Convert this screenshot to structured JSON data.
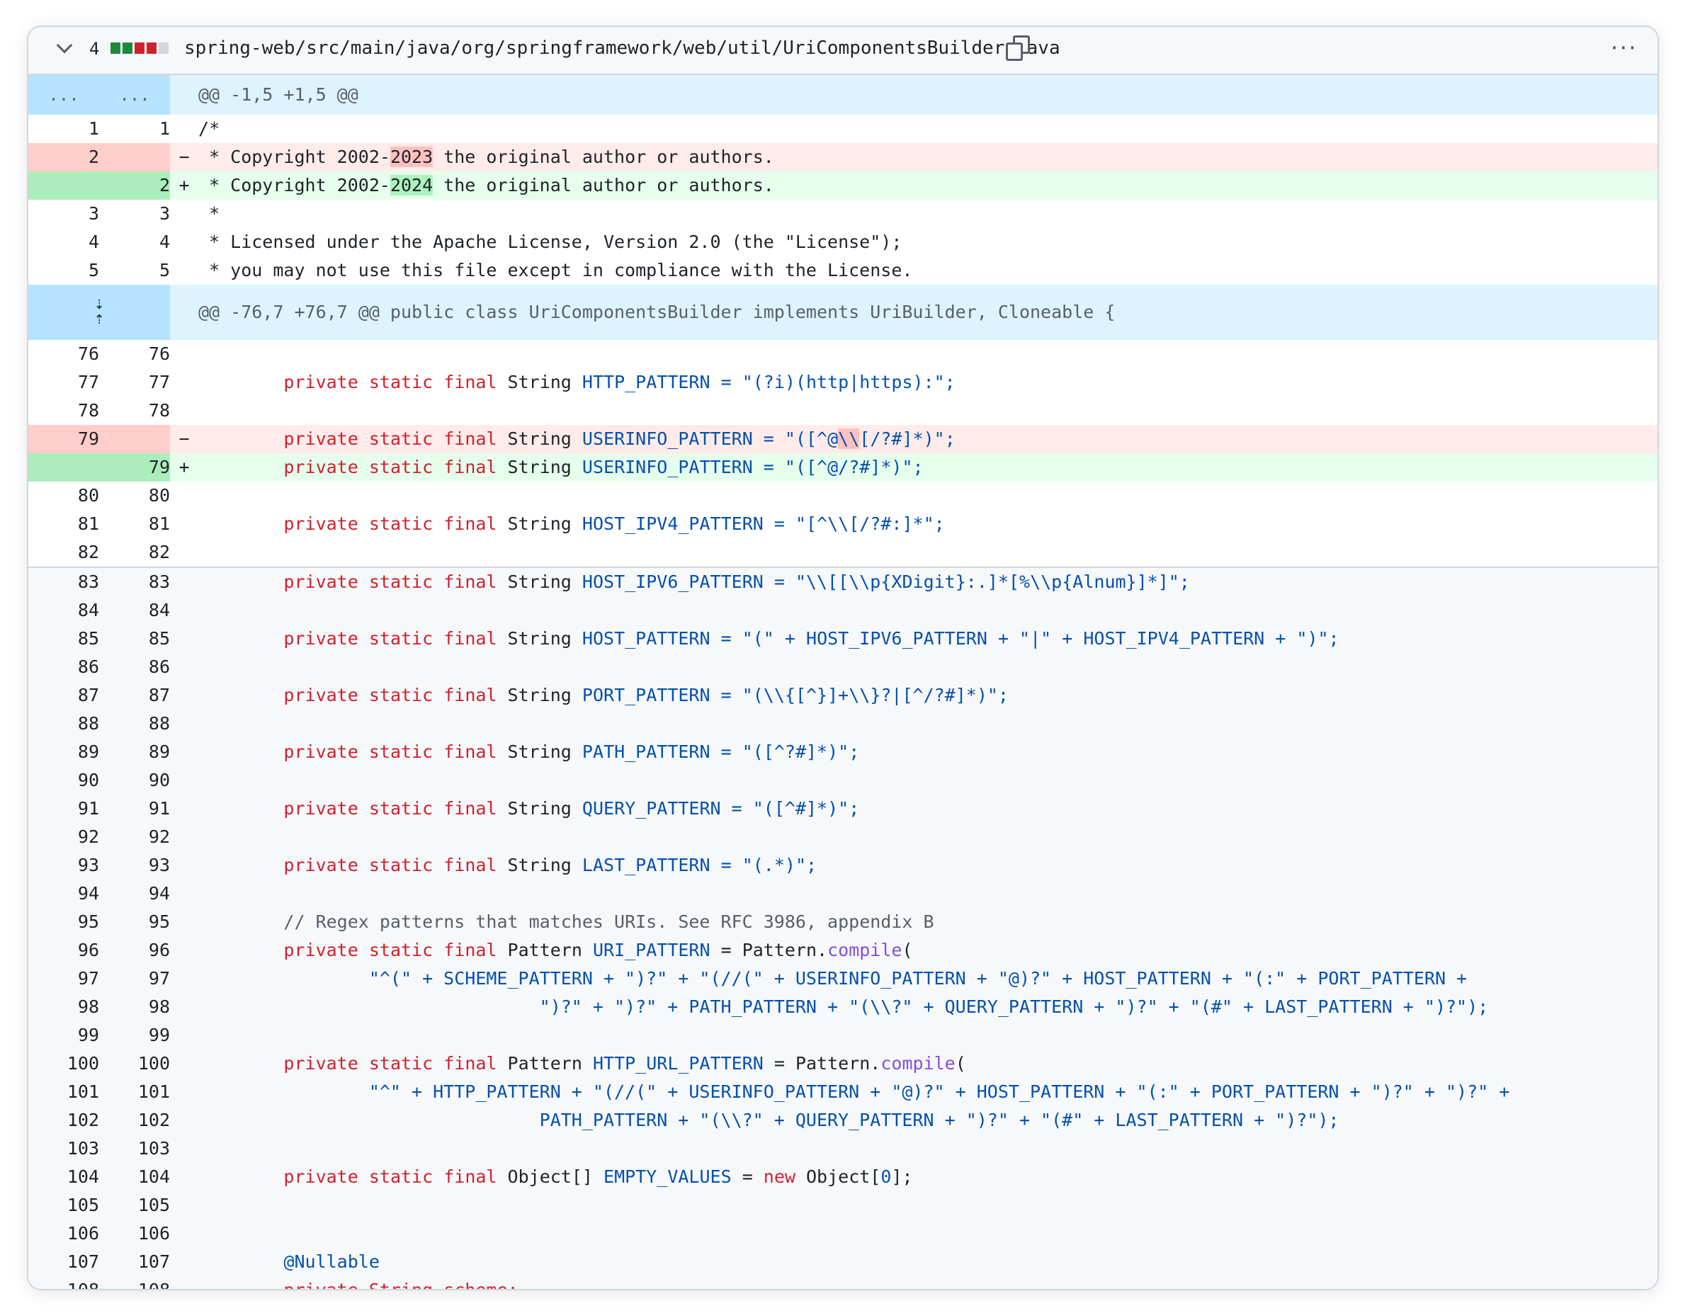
{
  "file": {
    "changes_count": "4",
    "diffstat_colors": [
      "#1f883d",
      "#1f883d",
      "#cf222e",
      "#cf222e",
      "#d0d7de"
    ],
    "path": "spring-web/src/main/java/org/springframework/web/util/UriComponentsBuilder.java"
  },
  "hunks": [
    {
      "old_ellipsis": "...",
      "new_ellipsis": "...",
      "header": "@@ -1,5 +1,5 @@"
    },
    {
      "header": "@@ -76,7 +76,7 @@ public class UriComponentsBuilder implements UriBuilder, Cloneable {"
    }
  ],
  "lines": {
    "l1": {
      "old": "1",
      "new": "1",
      "text": "/*"
    },
    "l2d": {
      "old": "2",
      "marker": "−",
      "pre": " * Copyright 2002-",
      "hl": "2023",
      "post": " the original author or authors."
    },
    "l2a": {
      "new": "2",
      "marker": "+",
      "pre": " * Copyright 2002-",
      "hl": "2024",
      "post": " the original author or authors."
    },
    "l3": {
      "old": "3",
      "new": "3",
      "text": " *"
    },
    "l4": {
      "old": "4",
      "new": "4",
      "text": " * Licensed under the Apache License, Version 2.0 (the \"License\");"
    },
    "l5": {
      "old": "5",
      "new": "5",
      "text": " * you may not use this file except in compliance with the License."
    },
    "l76": {
      "old": "76",
      "new": "76"
    },
    "l77": {
      "old": "77",
      "new": "77",
      "name": "HTTP_PATTERN",
      "value": " = \"(?i)(http|https):\";"
    },
    "l78": {
      "old": "78",
      "new": "78"
    },
    "l79d": {
      "old": "79",
      "marker": "−",
      "name": "USERINFO_PATTERN",
      "pre": " = \"([^@",
      "hl": "\\\\",
      "post": "[/?#]*)\";"
    },
    "l79a": {
      "new": "79",
      "marker": "+",
      "name": "USERINFO_PATTERN",
      "value": " = \"([^@/?#]*)\";"
    },
    "l80": {
      "old": "80",
      "new": "80"
    },
    "l81": {
      "old": "81",
      "new": "81",
      "name": "HOST_IPV4_PATTERN",
      "value": " = \"[^\\\\[/?#:]*\";"
    },
    "l82": {
      "old": "82",
      "new": "82"
    },
    "l83": {
      "old": "83",
      "new": "83",
      "name": "HOST_IPV6_PATTERN",
      "value": " = \"\\\\[[\\\\p{XDigit}:.]*[%\\\\p{Alnum}]*]\";"
    },
    "l84": {
      "old": "84",
      "new": "84"
    },
    "l85": {
      "old": "85",
      "new": "85",
      "name": "HOST_PATTERN",
      "a": " = \"(\" + ",
      "b": "HOST_IPV6_PATTERN",
      "c": " + \"|\" + ",
      "d": "HOST_IPV4_PATTERN",
      "e": " + \")\";"
    },
    "l86": {
      "old": "86",
      "new": "86"
    },
    "l87": {
      "old": "87",
      "new": "87",
      "name": "PORT_PATTERN",
      "value": " = \"(\\\\{[^}]+\\\\}?|[^/?#]*)\";"
    },
    "l88": {
      "old": "88",
      "new": "88"
    },
    "l89": {
      "old": "89",
      "new": "89",
      "name": "PATH_PATTERN",
      "value": " = \"([^?#]*)\";"
    },
    "l90": {
      "old": "90",
      "new": "90"
    },
    "l91": {
      "old": "91",
      "new": "91",
      "name": "QUERY_PATTERN",
      "value": " = \"([^#]*)\";"
    },
    "l92": {
      "old": "92",
      "new": "92"
    },
    "l93": {
      "old": "93",
      "new": "93",
      "name": "LAST_PATTERN",
      "value": " = \"(.*)\";"
    },
    "l94": {
      "old": "94",
      "new": "94"
    },
    "l95": {
      "old": "95",
      "new": "95",
      "comment": "// Regex patterns that matches URIs. See RFC 3986, appendix B"
    },
    "l96": {
      "old": "96",
      "new": "96",
      "type": "Pattern",
      "name": "URI_PATTERN",
      "eq": " = Pattern.",
      "fn": "compile",
      "tail": "("
    },
    "l97": {
      "old": "97",
      "new": "97"
    },
    "l98": {
      "old": "98",
      "new": "98"
    },
    "l99": {
      "old": "99",
      "new": "99"
    },
    "l100": {
      "old": "100",
      "new": "100",
      "type": "Pattern",
      "name": "HTTP_URL_PATTERN",
      "eq": " = Pattern.",
      "fn": "compile",
      "tail": "("
    },
    "l101": {
      "old": "101",
      "new": "101"
    },
    "l102": {
      "old": "102",
      "new": "102"
    },
    "l103": {
      "old": "103",
      "new": "103"
    },
    "l104": {
      "old": "104",
      "new": "104",
      "type": "Object[] ",
      "name": "EMPTY_VALUES",
      "eq": " = ",
      "kwnew": "new",
      "tail1": " Object[",
      "zero": "0",
      "tail2": "];"
    },
    "l105": {
      "old": "105",
      "new": "105"
    },
    "l106": {
      "old": "106",
      "new": "106"
    },
    "l107": {
      "old": "107",
      "new": "107",
      "annotation": "@Nullable"
    },
    "l108": {
      "old": "108",
      "new": "108",
      "partial": "private String scheme;"
    }
  },
  "keywords": {
    "private": "private",
    "static": "static",
    "final": "final",
    "string": "String"
  }
}
